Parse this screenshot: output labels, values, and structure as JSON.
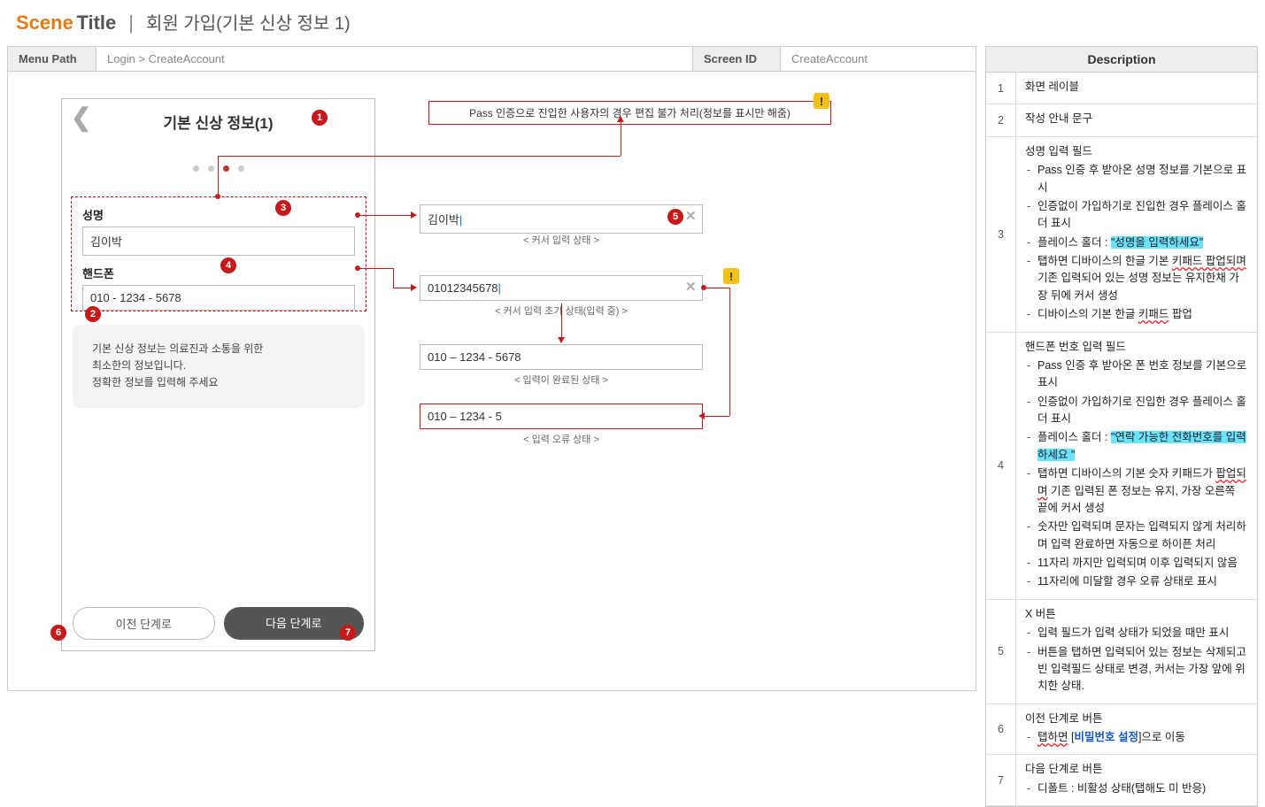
{
  "header": {
    "scene": "Scene",
    "title": "Title",
    "separator": "|",
    "subtitle": "회원 가입(기본 신상 정보 1)"
  },
  "meta": {
    "menu_path_label": "Menu Path",
    "menu_path_value": "Login > CreateAccount",
    "screen_id_label": "Screen ID",
    "screen_id_value": "CreateAccount"
  },
  "phone": {
    "title": "기본 신상 정보(1)",
    "name_label": "성명",
    "name_value": "김이박",
    "phone_label": "핸드폰",
    "phone_value": "010 - 1234 - 5678",
    "info_line1": "기본 신상 정보는 의료진과 소통을 위한",
    "info_line2": "최소한의 정보입니다.",
    "info_line3": "정확한 정보를  입력해 주세요",
    "btn_prev": "이전  단계로",
    "btn_next": "다음 단계로"
  },
  "callouts": {
    "pass_note": "Pass 인증으로 진입한 사용자의 경우 편집 불가 처리(정보를 표시만 해줌)",
    "name_cursor_value": "김이박",
    "name_cursor_caption": "< 커서 입력 상태 >",
    "phone_typing_value": "01012345678",
    "phone_typing_caption": "< 커서 입력 초기 상태(입력 중) >",
    "phone_done_value": "010 – 1234 - 5678",
    "phone_done_caption": "< 입력이 완료된 상태 >",
    "phone_err_value": "010 – 1234 - 5",
    "phone_err_caption": "< 입력 오류 상태 >",
    "warn_char": "!"
  },
  "markers": {
    "n1": "1",
    "n2": "2",
    "n3": "3",
    "n4": "4",
    "n5": "5",
    "n6": "6",
    "n7": "7"
  },
  "desc": {
    "heading": "Description",
    "rows": [
      {
        "num": "1",
        "title": "화면 레이블",
        "items": []
      },
      {
        "num": "2",
        "title": "작성 안내 문구",
        "items": []
      },
      {
        "num": "3",
        "title": "성명 입력 필드",
        "items": [
          {
            "pre": "Pass 인증 후 받아온 성명 정보를 기본으로 표시"
          },
          {
            "pre": "인증없이 가입하기로 진입한 경우 플레이스 홀더 표시"
          },
          {
            "pre": "플레이스 홀더 : ",
            "hl": "\"성명을 입력하세요\""
          },
          {
            "pre": "탭하면 디바이스의 한글 기본 ",
            "wavy": "키패드 팝업되며",
            "post": " 기존 입력되어 있는 성명 정보는 유지한채 가장 뒤에 커서 생성"
          },
          {
            "pre": "디바이스의 기본 한글 ",
            "wavy": "키패드",
            "post": " 팝업"
          }
        ]
      },
      {
        "num": "4",
        "title": "핸드폰 번호 입력 필드",
        "items": [
          {
            "pre": "Pass 인증 후 받아온 폰 번호 정보를 기본으로 표시"
          },
          {
            "pre": "인증없이 가입하기로 진입한 경우 플레이스 홀더 표시"
          },
          {
            "pre": "플레이스 홀더 : ",
            "hl": "\"연락 가능한 전화번호를 입력하세요 \""
          },
          {
            "pre": "탭하면 디바이스의 기본 숫자 키패드가 ",
            "wavy": "팝업되며",
            "post": " 기존 입력된 폰 정보는 유지, 가장 오른쪽 끝에 커서 생성"
          },
          {
            "pre": "숫자만 입력되며 문자는 입력되지 않게 처리하며 입력 완료하면 자동으로 하이픈 처리"
          },
          {
            "pre": "11자리 까지만 입력되며 이후 입력되지 않음"
          },
          {
            "pre": "11자리에 미달할 경우 오류 상태로 표시"
          }
        ]
      },
      {
        "num": "5",
        "title": "X 버튼",
        "items": [
          {
            "pre": "입력 필드가 입력 상태가 되었을 때만 표시"
          },
          {
            "pre": "버튼을 탭하면 입력되어 있는 정보는 삭제되고 빈 입력필드 상태로 변경, 커서는 가장 앞에 위치한 상태."
          }
        ]
      },
      {
        "num": "6",
        "title": "이전 단계로 버튼",
        "items": [
          {
            "wavy": "탭하면",
            "post": " [",
            "link": "비밀번호 설정",
            "post2": "]으로 이동"
          }
        ]
      },
      {
        "num": "7",
        "title": "다음 단계로 버튼",
        "items": [
          {
            "pre": "디폴트 : 비활성 상태(탭해도 미 반응)"
          }
        ]
      }
    ]
  }
}
